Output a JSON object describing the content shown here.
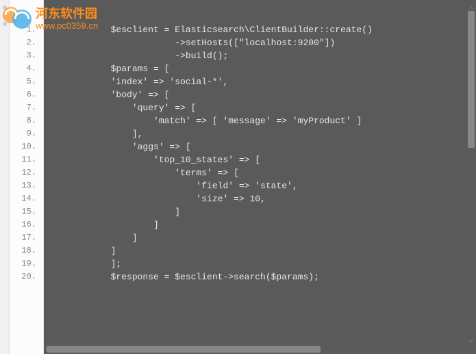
{
  "watermark": {
    "site_name": "河东软件园",
    "site_url": "www.pc0359.cn"
  },
  "editor": {
    "line_numbers": [
      "1.",
      "2.",
      "3.",
      "4.",
      "5.",
      "6.",
      "7.",
      "8.",
      "9.",
      "10.",
      "11.",
      "12.",
      "13.",
      "14.",
      "15.",
      "16.",
      "17.",
      "18.",
      "19.",
      "20."
    ],
    "code_lines": [
      "            $esclient = Elasticsearch\\ClientBuilder::create()",
      "                        ->setHosts([\"localhost:9200\"])",
      "                        ->build();",
      "            $params = [",
      "            'index' => 'social-*',",
      "            'body' => [",
      "                'query' => [",
      "                    'match' => [ 'message' => 'myProduct' ]",
      "                ],",
      "                'aggs' => [",
      "                    'top_10_states' => [",
      "                        'terms' => [",
      "                            'field' => 'state',",
      "                            'size' => 10,",
      "                        ]",
      "                    ]",
      "                ]",
      "            ]",
      "            ];",
      "            $response = $esclient->search($params);"
    ]
  }
}
